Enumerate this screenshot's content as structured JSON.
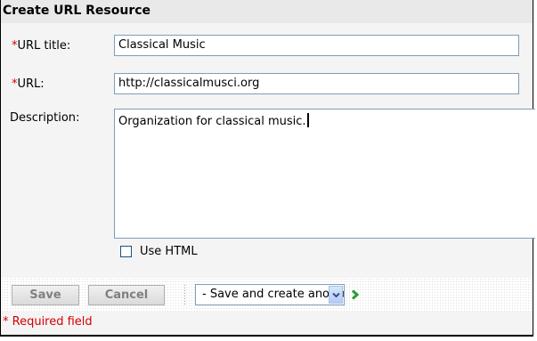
{
  "dialog": {
    "title": "Create URL Resource"
  },
  "form": {
    "url_title": {
      "required_mark": "*",
      "label": "URL title:",
      "value": "Classical Music"
    },
    "url": {
      "required_mark": "*",
      "label": "URL:",
      "value": "http://classicalmusci.org"
    },
    "description": {
      "label": "Description:",
      "value": "Organization for classical music."
    },
    "use_html": {
      "label": "Use HTML",
      "checked": false
    }
  },
  "buttons": {
    "save_label": "Save",
    "cancel_label": "Cancel",
    "save_action_selected": "- Save and create another -"
  },
  "footer": {
    "required_mark": "*",
    "required_note": " Required field"
  },
  "colors": {
    "required": "#d40000",
    "go_arrow": "#2e9a2e",
    "disabled_text": "#808080"
  },
  "icons": {
    "select_arrow": "chevron-down-icon",
    "go": "go-arrow-icon"
  }
}
